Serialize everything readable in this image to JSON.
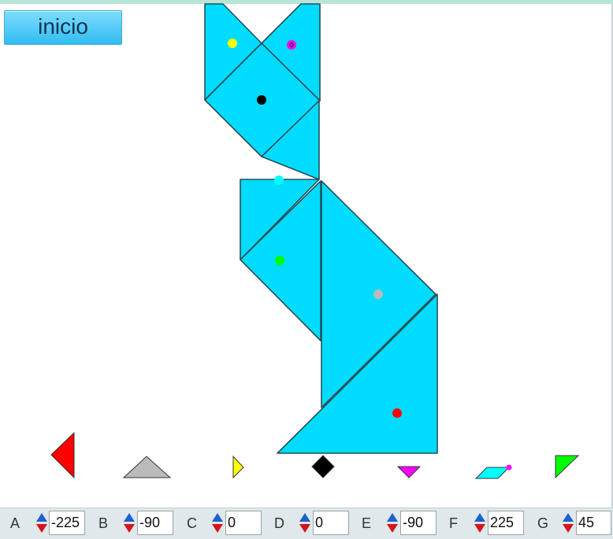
{
  "app": {
    "start_button": "inicio"
  },
  "colors": {
    "piece_fill": "#00dcff",
    "piece_stroke": "#25505a",
    "background": "#ffffff"
  },
  "pieces": [
    {
      "id": "A",
      "color": "#ff0000",
      "shape": "large-triangle",
      "rotation": -225
    },
    {
      "id": "B",
      "color": "#bbbbbb",
      "shape": "large-triangle",
      "rotation": -90
    },
    {
      "id": "C",
      "color": "#ffff00",
      "shape": "small-triangle",
      "rotation": 0
    },
    {
      "id": "D",
      "color": "#000000",
      "shape": "square",
      "rotation": 0
    },
    {
      "id": "E",
      "color": "#ff00ff",
      "shape": "small-triangle",
      "rotation": -90
    },
    {
      "id": "F",
      "color": "#00ffff",
      "shape": "parallelogram",
      "rotation": 225
    },
    {
      "id": "G",
      "color": "#00ff00",
      "shape": "medium-triangle",
      "rotation": 45
    }
  ],
  "controls": [
    {
      "label": "A",
      "value": "-225"
    },
    {
      "label": "B",
      "value": "-90"
    },
    {
      "label": "C",
      "value": "0"
    },
    {
      "label": "D",
      "value": "0"
    },
    {
      "label": "E",
      "value": "-90"
    },
    {
      "label": "F",
      "value": "225"
    },
    {
      "label": "G",
      "value": "45"
    }
  ]
}
